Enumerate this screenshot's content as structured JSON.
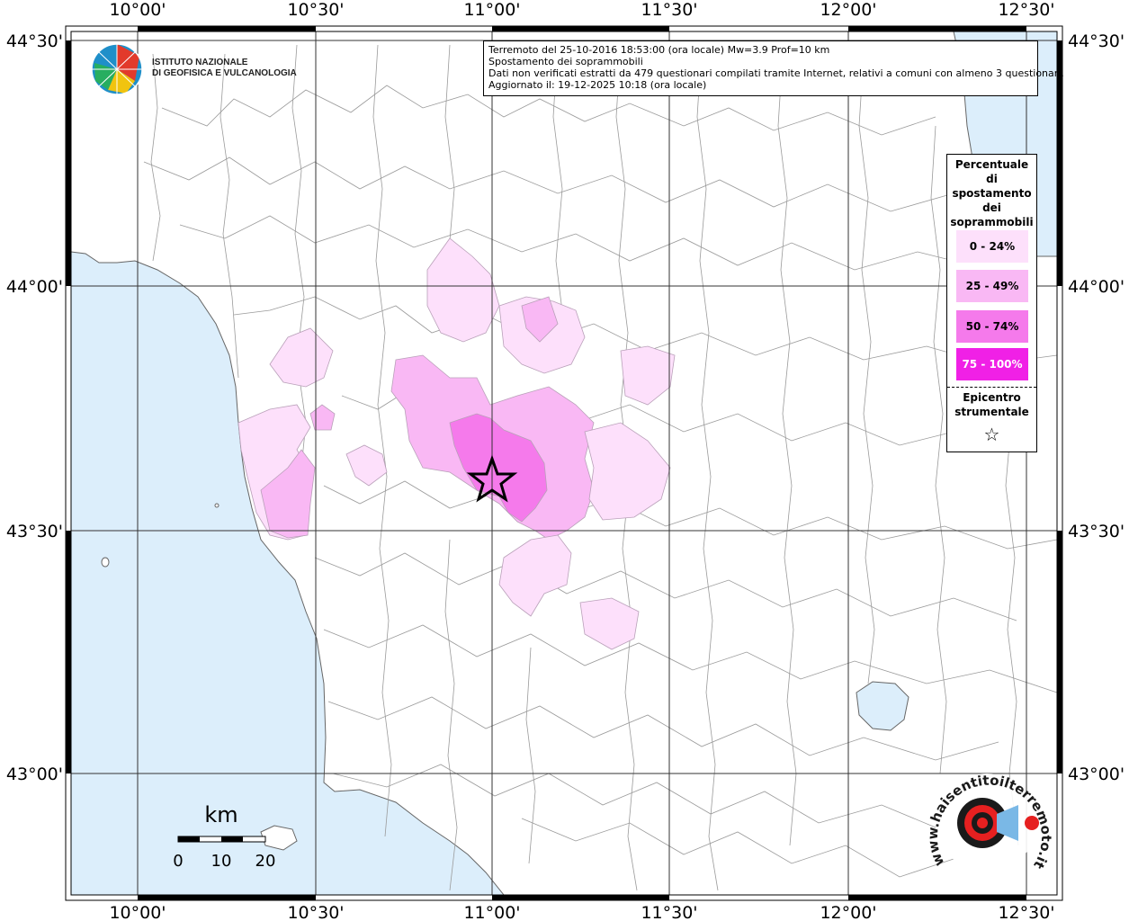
{
  "axes": {
    "lon_labels": [
      "10°00'",
      "10°30'",
      "11°00'",
      "11°30'",
      "12°00'",
      "12°30'"
    ],
    "lat_labels": [
      "44°30'",
      "44°00'",
      "43°30'",
      "43°00'"
    ]
  },
  "info": {
    "line1": "Terremoto del 25-10-2016 18:53:00 (ora locale) Mw=3.9 Prof=10 km",
    "line2": "Spostamento dei soprammobili",
    "line3": "Dati non verificati estratti da 479 questionari compilati tramite Internet, relativi a comuni con almeno 3 questionari.",
    "line4": "Aggiornato il: 19-12-2025 10:18 (ora locale)"
  },
  "logo": {
    "line1": "ISTITUTO NAZIONALE",
    "line2": "DI GEOFISICA E VULCANOLOGIA"
  },
  "legend": {
    "title_lines": [
      "Percentuale",
      "di",
      "spostamento",
      "dei",
      "soprammobili"
    ],
    "classes": [
      {
        "label": "0 - 24%",
        "color": "#fde0fb"
      },
      {
        "label": "25 - 49%",
        "color": "#f9b8f4"
      },
      {
        "label": "50 - 74%",
        "color": "#f57aeb"
      },
      {
        "label": "75 - 100%",
        "color": "#f020e6"
      }
    ],
    "epicenter_line1": "Epicentro",
    "epicenter_line2": "strumentale",
    "epicenter_symbol": "☆"
  },
  "scalebar": {
    "unit": "km",
    "ticks": [
      "0",
      "10",
      "20"
    ]
  },
  "watermark": {
    "text": "www.haisentitoilterremoto.it"
  },
  "colors": {
    "sea": "#dceefb",
    "land": "#ffffff",
    "boundary": "#9a9a9a"
  }
}
